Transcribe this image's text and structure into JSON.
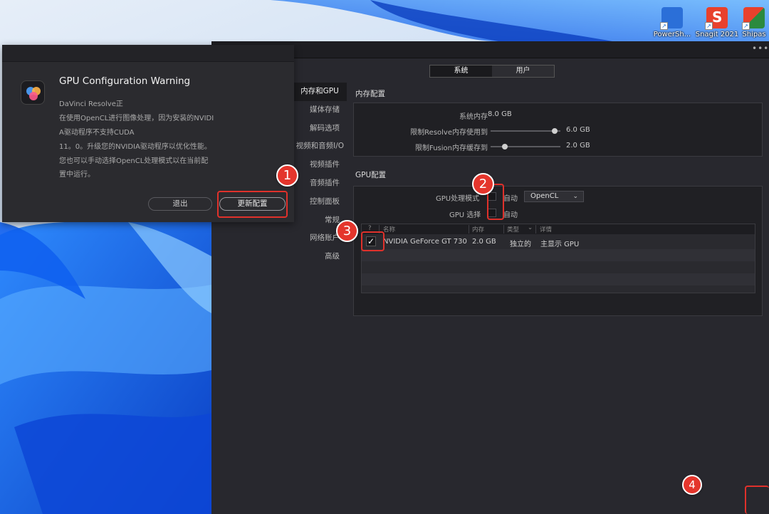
{
  "desktop_icons": [
    {
      "label": "PowerSh...",
      "icon": "powershell-icon",
      "color": "#2b6fd8"
    },
    {
      "label": "Snagit 2021",
      "icon": "snagit-icon",
      "color": "#e8412c"
    },
    {
      "label": "Shipas",
      "icon": "shipas-icon",
      "color": "#2b8a3e"
    }
  ],
  "dialog": {
    "title": "GPU Configuration Warning",
    "lines": [
      "DaVinci Resolve正",
      "在使用OpenCL进行图像处理，因为安装的NVIDI",
      "A驱动程序不支持CUDA",
      "11。0。升级您的NVIDIA驱动程序以优化性能。",
      "您也可以手动选择OpenCL处理模式以在当前配",
      "置中运行。"
    ],
    "quit_label": "退出",
    "update_label": "更新配置"
  },
  "prefs": {
    "more_label": "•••",
    "tabs": [
      {
        "label": "系统",
        "active": true
      },
      {
        "label": "用户",
        "active": false
      }
    ],
    "sidebar": [
      {
        "label": "内存和GPU",
        "active": true
      },
      {
        "label": "媒体存储",
        "active": false
      },
      {
        "label": "解码选项",
        "active": false
      },
      {
        "label": "视频和音频I/O",
        "active": false
      },
      {
        "label": "视频插件",
        "active": false
      },
      {
        "label": "音频插件",
        "active": false
      },
      {
        "label": "控制面板",
        "active": false
      },
      {
        "label": "常规",
        "active": false
      },
      {
        "label": "网络账户",
        "active": false
      },
      {
        "label": "高级",
        "active": false
      }
    ],
    "memory": {
      "title": "内存配置",
      "system_memory_label": "系统内存",
      "system_memory_value": "8.0 GB",
      "resolve_limit_label": "限制Resolve内存使用到",
      "resolve_limit_value": "6.0 GB",
      "resolve_limit_fraction": 0.95,
      "fusion_limit_label": "限制Fusion内存缓存到",
      "fusion_limit_value": "2.0 GB",
      "fusion_limit_fraction": 0.18
    },
    "gpu": {
      "title": "GPU配置",
      "mode_label": "GPU处理模式",
      "mode_auto_label": "自动",
      "mode_auto_checked": false,
      "mode_select_value": "OpenCL",
      "select_label": "GPU 选择",
      "select_auto_label": "自动",
      "select_auto_checked": false,
      "table": {
        "headers": {
          "check": "?",
          "name": "名称",
          "memory": "内存",
          "type": "类型",
          "details": "详情"
        },
        "rows": [
          {
            "checked": true,
            "check_mark": "✓",
            "name": "NVIDIA GeForce GT 730",
            "memory": "2.0 GB",
            "type": "独立的",
            "details": "主显示 GPU"
          }
        ]
      }
    }
  },
  "annotations": [
    "1",
    "2",
    "3",
    "4"
  ],
  "accent": {
    "annotation_red": "#e0312b",
    "panel_bg": "#28282e"
  }
}
